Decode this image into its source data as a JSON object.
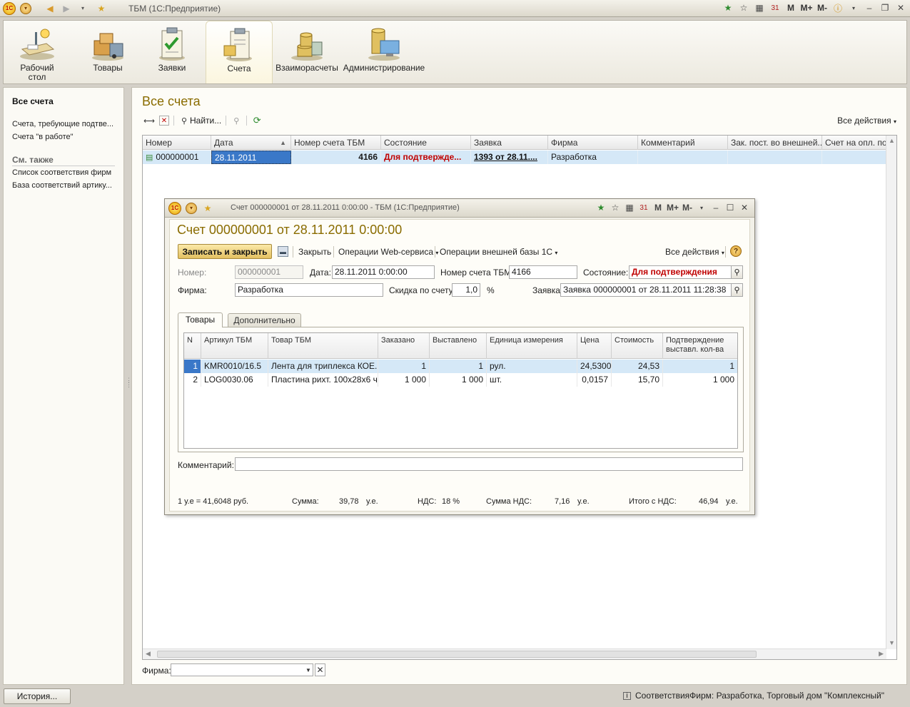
{
  "window": {
    "title": "ТБМ  (1С:Предприятие)",
    "right_tools": [
      "M",
      "M+",
      "M-"
    ]
  },
  "sections": [
    {
      "label": "Рабочий стол",
      "icon": "desk-icon"
    },
    {
      "label": "Товары",
      "icon": "goods-icon"
    },
    {
      "label": "Заявки",
      "icon": "requests-icon"
    },
    {
      "label": "Счета",
      "icon": "invoices-icon"
    },
    {
      "label": "Взаиморасчеты",
      "icon": "settlements-icon"
    },
    {
      "label": "Администрирование",
      "icon": "admin-icon"
    }
  ],
  "sidebar": {
    "title": "Все счета",
    "links": [
      "Счета, требующие подтве...",
      "Счета \"в работе\""
    ],
    "see_also": "См. также",
    "see_also_links": [
      "Список соответствия фирм",
      "База соответствий артику..."
    ]
  },
  "main": {
    "title": "Все счета",
    "find_label": "Найти...",
    "all_actions": "Все действия",
    "columns": [
      "Номер",
      "Дата",
      "Номер счета ТБМ",
      "Состояние",
      "Заявка",
      "Фирма",
      "Комментарий",
      "Зак. пост. во внешней...",
      "Счет на опл. пост"
    ],
    "row": {
      "number": "000000001",
      "date": "28.11.2011",
      "tbm_number": "4166",
      "state": "Для подтвержде...",
      "request": "1393 от 28.11....",
      "firm": "Разработка",
      "comment": "",
      "ext": "",
      "pay": ""
    },
    "firm_filter_label": "Фирма:",
    "firm_filter_value": ""
  },
  "dialog": {
    "window_title": "Счет 000000001 от 28.11.2011 0:00:00 - ТБМ  (1С:Предприятие)",
    "heading": "Счет 000000001 от 28.11.2011 0:00:00",
    "save_close": "Записать и закрыть",
    "close": "Закрыть",
    "web_ops": "Операции Web-сервиса",
    "ext_ops": "Операции внешней базы 1С",
    "all_actions": "Все действия",
    "labels": {
      "number": "Номер:",
      "date": "Дата:",
      "tbm_number": "Номер счета ТБМ:",
      "state": "Состояние:",
      "firm": "Фирма:",
      "discount": "Скидка по счету:",
      "percent": "%",
      "request": "Заявка:",
      "comment": "Комментарий:"
    },
    "values": {
      "number": "000000001",
      "date": "28.11.2011  0:00:00",
      "tbm_number": "4166",
      "state": "Для подтверждения",
      "firm": "Разработка",
      "discount": "1,0",
      "request": "Заявка 000000001 от 28.11.2011 11:28:38",
      "comment": ""
    },
    "tabs": [
      "Товары",
      "Дополнительно"
    ],
    "grid_columns": [
      "N",
      "Артикул ТБМ",
      "Товар ТБМ",
      "Заказано",
      "Выставлено",
      "Единица измерения",
      "Цена",
      "Стоимость",
      "Подтверждение выставл. кол-ва"
    ],
    "grid_rows": [
      {
        "n": "1",
        "article": "KMR0010/16.5",
        "product": "Лента для триплекса КОЕ...",
        "ordered": "1",
        "issued": "1",
        "unit": "рул.",
        "price": "24,5300",
        "cost": "24,53",
        "confirmed": "1"
      },
      {
        "n": "2",
        "article": "LOG0030.06",
        "product": "Пластина рихт. 100х28х6 ч...",
        "ordered": "1 000",
        "issued": "1 000",
        "unit": "шт.",
        "price": "0,0157",
        "cost": "15,70",
        "confirmed": "1 000"
      }
    ],
    "totals": {
      "rate": "1 у.е = 41,6048 руб.",
      "sum_label": "Сумма:",
      "sum": "39,78",
      "sum_unit": "у.е.",
      "vat_label": "НДС:",
      "vat": "18 %",
      "vat_sum_label": "Сумма НДС:",
      "vat_sum": "7,16",
      "vat_sum_unit": "у.е.",
      "total_label": "Итого с НДС:",
      "total": "46,94",
      "total_unit": "у.е."
    }
  },
  "statusbar": {
    "history": "История...",
    "message": "СоответствияФирм: Разработка, Торговый дом \"Комплексный\""
  }
}
